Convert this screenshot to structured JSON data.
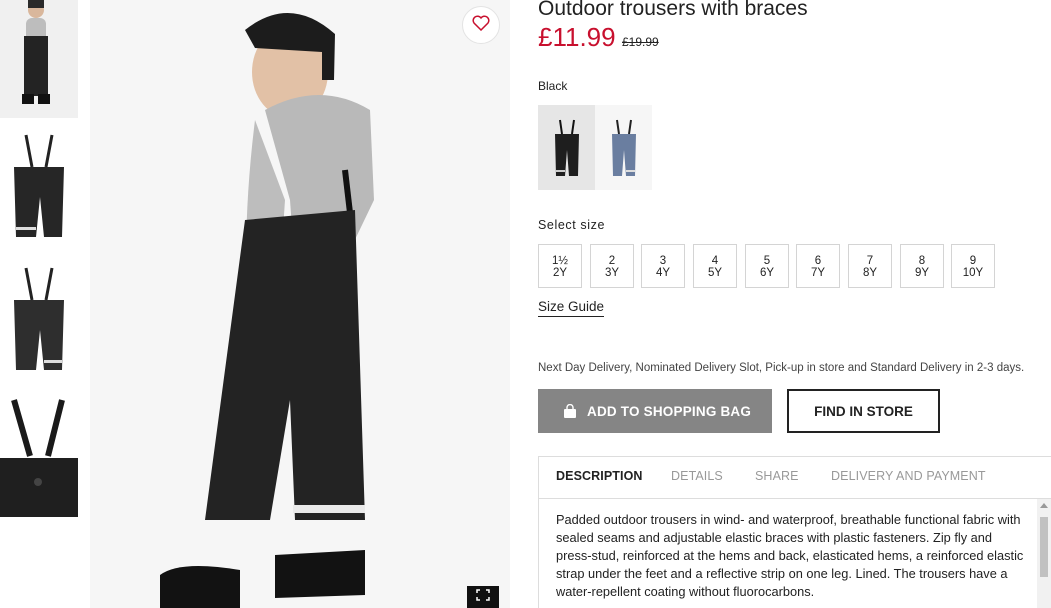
{
  "product": {
    "title": "Outdoor trousers with braces",
    "price": "£11.99",
    "old_price": "£19.99",
    "color_label": "Black"
  },
  "swatches": [
    {
      "name": "Black",
      "color": "#1e1e1e"
    },
    {
      "name": "Blue",
      "color": "#6a7ea0"
    }
  ],
  "sizes": {
    "label": "Select size",
    "options": [
      {
        "line1": "1½",
        "line2": "2Y"
      },
      {
        "line1": "2",
        "line2": "3Y"
      },
      {
        "line1": "3",
        "line2": "4Y"
      },
      {
        "line1": "4",
        "line2": "5Y"
      },
      {
        "line1": "5",
        "line2": "6Y"
      },
      {
        "line1": "6",
        "line2": "7Y"
      },
      {
        "line1": "7",
        "line2": "8Y"
      },
      {
        "line1": "8",
        "line2": "9Y"
      },
      {
        "line1": "9",
        "line2": "10Y"
      }
    ],
    "guide_label": "Size Guide"
  },
  "delivery_text": "Next Day Delivery, Nominated Delivery Slot, Pick-up in store and Standard Delivery in 2-3 days.",
  "buttons": {
    "add_to_bag": "ADD TO SHOPPING BAG",
    "find_in_store": "FIND IN STORE"
  },
  "tabs": [
    {
      "label": "DESCRIPTION",
      "active": true
    },
    {
      "label": "DETAILS",
      "active": false
    },
    {
      "label": "SHARE",
      "active": false
    },
    {
      "label": "DELIVERY AND PAYMENT",
      "active": false
    }
  ],
  "description": "Padded outdoor trousers in wind- and waterproof, breathable functional fabric with sealed seams and adjustable elastic braces with plastic fasteners. Zip fly and press-stud, reinforced at the hems and back, elasticated hems, a reinforced elastic strap under the feet and a reflective strip on one leg. Lined. The trousers have a water-repellent coating without fluorocarbons.",
  "colors": {
    "price_red": "#c8102e",
    "bag_button": "#858585",
    "fabric_black": "#1e1e1e"
  },
  "icons": {
    "favorite": "heart-icon",
    "fullscreen": "expand-icon",
    "bag": "shopping-bag-icon"
  }
}
